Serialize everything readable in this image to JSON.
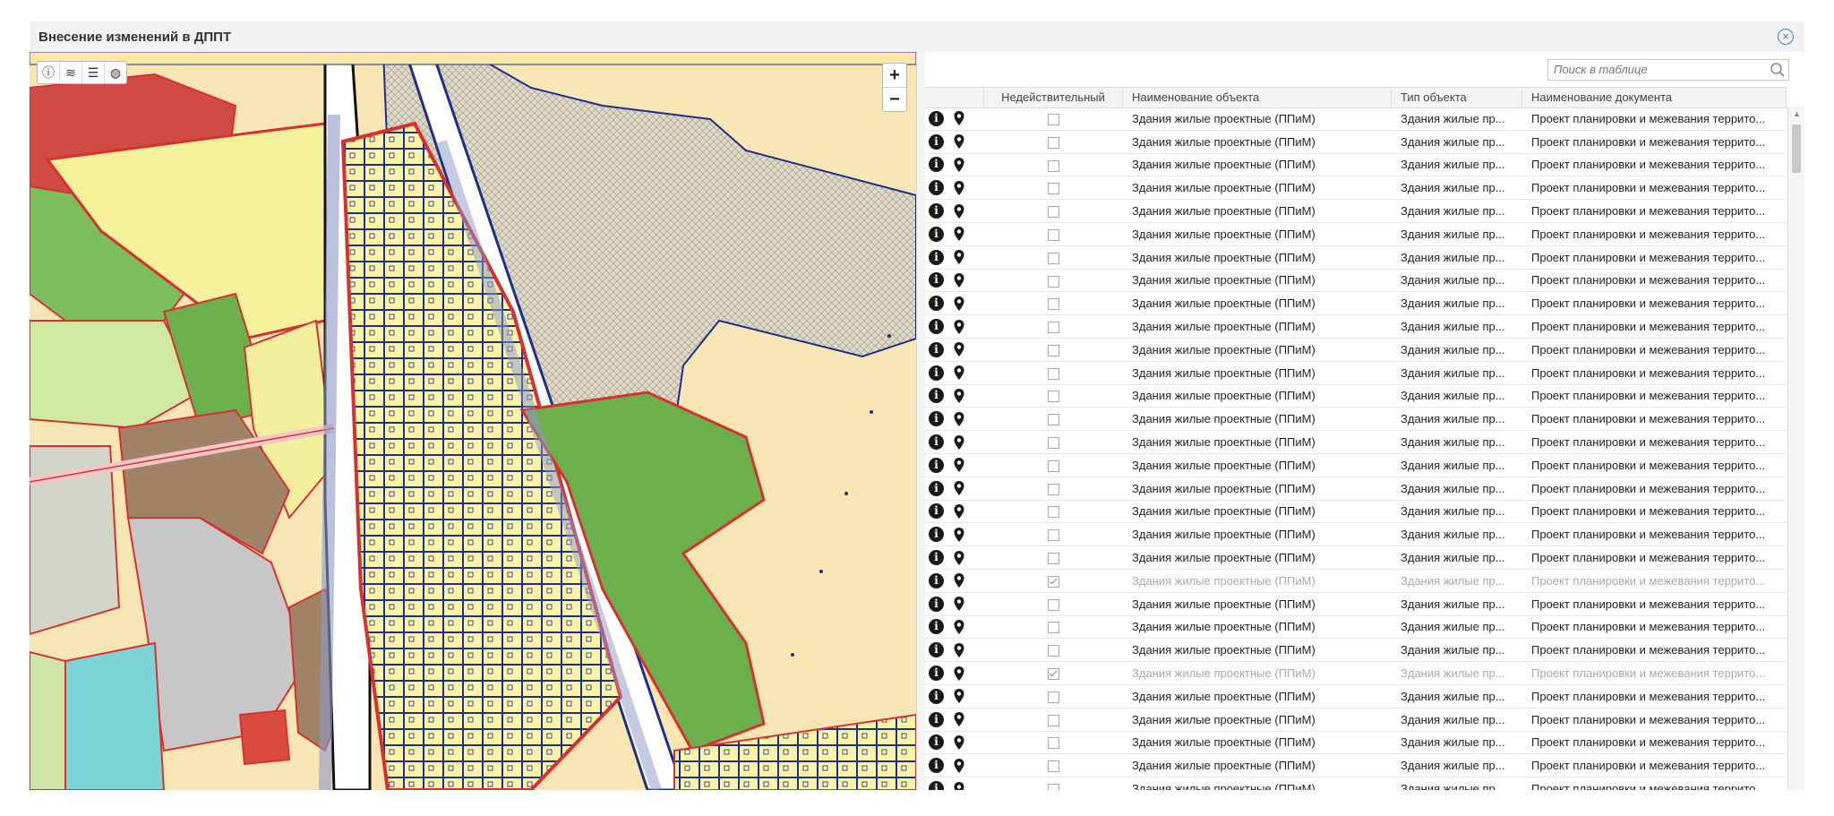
{
  "window": {
    "title": "Внесение изменений в ДППТ"
  },
  "icons": {
    "close": "close-circle-icon",
    "info": "info-circle-icon",
    "layers": "layers-icon",
    "legend": "list-icon",
    "basemap": "globe-icon",
    "pin": "map-marker-icon",
    "search": "magnifier-icon"
  },
  "map": {
    "zoom_in": "+",
    "zoom_out": "−"
  },
  "table": {
    "search_placeholder": "Поиск в таблице",
    "columns": [
      "Недействительный",
      "Наименование объекта",
      "Тип объекта",
      "Наименование документа"
    ],
    "rows": [
      {
        "invalid": false,
        "name": "Здания жилые проектные (ППиМ)",
        "type": "Здания жилые пр...",
        "document": "Проект планировки и межевания террито..."
      },
      {
        "invalid": false,
        "name": "Здания жилые проектные (ППиМ)",
        "type": "Здания жилые пр...",
        "document": "Проект планировки и межевания террито..."
      },
      {
        "invalid": false,
        "name": "Здания жилые проектные (ППиМ)",
        "type": "Здания жилые пр...",
        "document": "Проект планировки и межевания террито..."
      },
      {
        "invalid": false,
        "name": "Здания жилые проектные (ППиМ)",
        "type": "Здания жилые пр...",
        "document": "Проект планировки и межевания террито..."
      },
      {
        "invalid": false,
        "name": "Здания жилые проектные (ППиМ)",
        "type": "Здания жилые пр...",
        "document": "Проект планировки и межевания террито..."
      },
      {
        "invalid": false,
        "name": "Здания жилые проектные (ППиМ)",
        "type": "Здания жилые пр...",
        "document": "Проект планировки и межевания террито..."
      },
      {
        "invalid": false,
        "name": "Здания жилые проектные (ППиМ)",
        "type": "Здания жилые пр...",
        "document": "Проект планировки и межевания террито..."
      },
      {
        "invalid": false,
        "name": "Здания жилые проектные (ППиМ)",
        "type": "Здания жилые пр...",
        "document": "Проект планировки и межевания террито..."
      },
      {
        "invalid": false,
        "name": "Здания жилые проектные (ППиМ)",
        "type": "Здания жилые пр...",
        "document": "Проект планировки и межевания террито..."
      },
      {
        "invalid": false,
        "name": "Здания жилые проектные (ППиМ)",
        "type": "Здания жилые пр...",
        "document": "Проект планировки и межевания террито..."
      },
      {
        "invalid": false,
        "name": "Здания жилые проектные (ППиМ)",
        "type": "Здания жилые пр...",
        "document": "Проект планировки и межевания террито..."
      },
      {
        "invalid": false,
        "name": "Здания жилые проектные (ППиМ)",
        "type": "Здания жилые пр...",
        "document": "Проект планировки и межевания террито..."
      },
      {
        "invalid": false,
        "name": "Здания жилые проектные (ППиМ)",
        "type": "Здания жилые пр...",
        "document": "Проект планировки и межевания террито..."
      },
      {
        "invalid": false,
        "name": "Здания жилые проектные (ППиМ)",
        "type": "Здания жилые пр...",
        "document": "Проект планировки и межевания террито..."
      },
      {
        "invalid": false,
        "name": "Здания жилые проектные (ППиМ)",
        "type": "Здания жилые пр...",
        "document": "Проект планировки и межевания террито..."
      },
      {
        "invalid": false,
        "name": "Здания жилые проектные (ППиМ)",
        "type": "Здания жилые пр...",
        "document": "Проект планировки и межевания террито..."
      },
      {
        "invalid": false,
        "name": "Здания жилые проектные (ППиМ)",
        "type": "Здания жилые пр...",
        "document": "Проект планировки и межевания террито..."
      },
      {
        "invalid": false,
        "name": "Здания жилые проектные (ППиМ)",
        "type": "Здания жилые пр...",
        "document": "Проект планировки и межевания террито..."
      },
      {
        "invalid": false,
        "name": "Здания жилые проектные (ППиМ)",
        "type": "Здания жилые пр...",
        "document": "Проект планировки и межевания террито..."
      },
      {
        "invalid": false,
        "name": "Здания жилые проектные (ППиМ)",
        "type": "Здания жилые пр...",
        "document": "Проект планировки и межевания террито..."
      },
      {
        "invalid": true,
        "name": "Здания жилые проектные (ППиМ)",
        "type": "Здания жилые пр...",
        "document": "Проект планировки и межевания террито..."
      },
      {
        "invalid": false,
        "name": "Здания жилые проектные (ППиМ)",
        "type": "Здания жилые пр...",
        "document": "Проект планировки и межевания террито..."
      },
      {
        "invalid": false,
        "name": "Здания жилые проектные (ППиМ)",
        "type": "Здания жилые пр...",
        "document": "Проект планировки и межевания террито..."
      },
      {
        "invalid": false,
        "name": "Здания жилые проектные (ППиМ)",
        "type": "Здания жилые пр...",
        "document": "Проект планировки и межевания террито..."
      },
      {
        "invalid": true,
        "name": "Здания жилые проектные (ППиМ)",
        "type": "Здания жилые пр...",
        "document": "Проект планировки и межевания террито..."
      },
      {
        "invalid": false,
        "name": "Здания жилые проектные (ППиМ)",
        "type": "Здания жилые пр...",
        "document": "Проект планировки и межевания террито..."
      },
      {
        "invalid": false,
        "name": "Здания жилые проектные (ППиМ)",
        "type": "Здания жилые пр...",
        "document": "Проект планировки и межевания террито..."
      },
      {
        "invalid": false,
        "name": "Здания жилые проектные (ППиМ)",
        "type": "Здания жилые пр...",
        "document": "Проект планировки и межевания террито..."
      },
      {
        "invalid": false,
        "name": "Здания жилые проектные (ППиМ)",
        "type": "Здания жилые пр...",
        "document": "Проект планировки и межевания террито..."
      },
      {
        "invalid": false,
        "name": "Здания жилые проектные (ППиМ)",
        "type": "Здания жилые пр...",
        "document": "Проект планировки и межевания террито..."
      }
    ]
  }
}
